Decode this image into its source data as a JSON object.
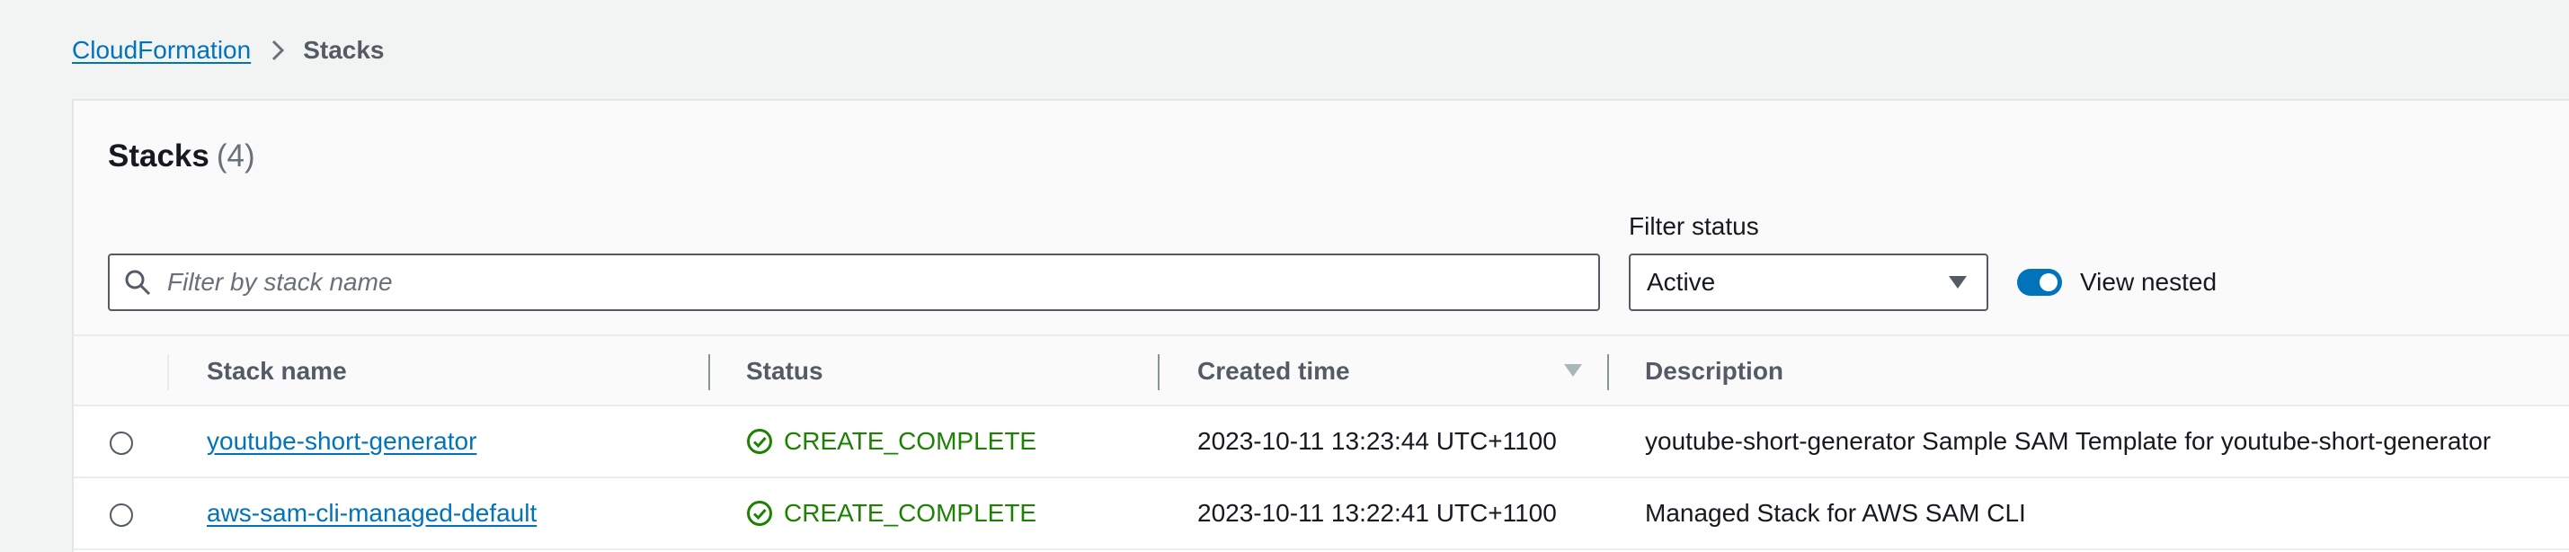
{
  "breadcrumb": {
    "root": "CloudFormation",
    "current": "Stacks"
  },
  "panel": {
    "title": "Stacks",
    "count": "(4)"
  },
  "search": {
    "placeholder": "Filter by stack name",
    "value": ""
  },
  "filter": {
    "label": "Filter status",
    "selected": "Active"
  },
  "view_nested": {
    "label": "View nested",
    "enabled": true
  },
  "table": {
    "columns": {
      "stack_name": "Stack name",
      "status": "Status",
      "created_time": "Created time",
      "description": "Description"
    },
    "rows": [
      {
        "name": "youtube-short-generator",
        "status": "CREATE_COMPLETE",
        "created": "2023-10-11 13:23:44 UTC+1100",
        "description": "youtube-short-generator Sample SAM Template for youtube-short-generator"
      },
      {
        "name": "aws-sam-cli-managed-default",
        "status": "CREATE_COMPLETE",
        "created": "2023-10-11 13:22:41 UTC+1100",
        "description": "Managed Stack for AWS SAM CLI"
      }
    ]
  },
  "colors": {
    "link": "#0073bb",
    "success": "#1d8102",
    "toggle_on": "#0073bb"
  }
}
